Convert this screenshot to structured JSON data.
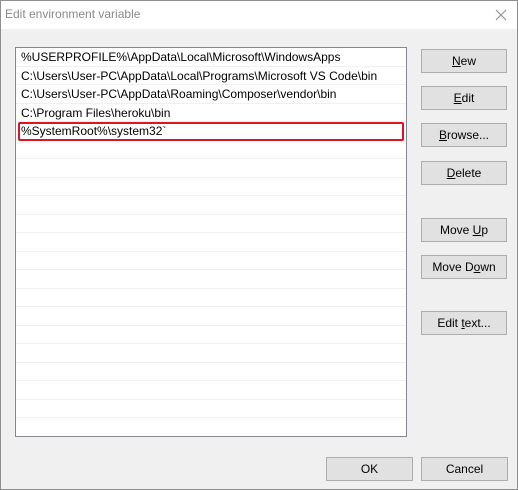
{
  "window": {
    "title": "Edit environment variable",
    "close_icon": "close-icon"
  },
  "paths": [
    "%USERPROFILE%\\AppData\\Local\\Microsoft\\WindowsApps",
    "C:\\Users\\User-PC\\AppData\\Local\\Programs\\Microsoft VS Code\\bin",
    "C:\\Users\\User-PC\\AppData\\Roaming\\Composer\\vendor\\bin",
    "C:\\Program Files\\heroku\\bin",
    "%SystemRoot%\\system32`"
  ],
  "highlight_color": "#e0141e",
  "buttons": {
    "new": {
      "pre": "",
      "key": "N",
      "post": "ew"
    },
    "edit": {
      "pre": "",
      "key": "E",
      "post": "dit"
    },
    "browse": {
      "pre": "",
      "key": "B",
      "post": "rowse..."
    },
    "delete": {
      "pre": "",
      "key": "D",
      "post": "elete"
    },
    "move_up": {
      "pre": "Move ",
      "key": "U",
      "post": "p"
    },
    "move_down": {
      "pre": "Move D",
      "key": "o",
      "post": "wn"
    },
    "edit_text": {
      "pre": "Edit ",
      "key": "t",
      "post": "ext..."
    }
  },
  "footer": {
    "ok": "OK",
    "cancel": "Cancel"
  }
}
